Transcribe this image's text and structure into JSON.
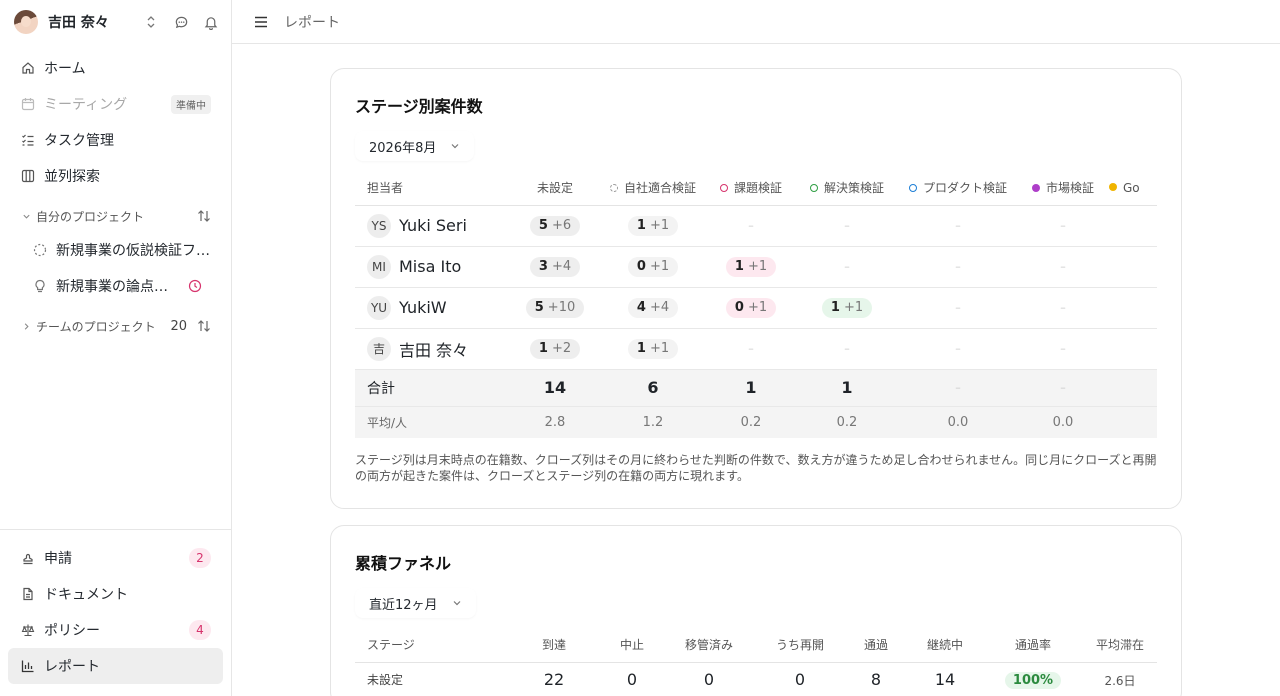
{
  "user": {
    "name": "吉田 奈々"
  },
  "nav": {
    "home": "ホーム",
    "meeting": "ミーティング",
    "meeting_badge": "準備中",
    "tasks": "タスク管理",
    "parallel": "並列探索"
  },
  "my_projects": {
    "title": "自分のプロジェクト",
    "items": [
      {
        "label": "新規事業の仮説検証フレームワーク"
      },
      {
        "label": "新規事業の論点整理"
      }
    ]
  },
  "team_projects": {
    "title": "チームのプロジェクト",
    "count": "20"
  },
  "bottom_nav": {
    "apply": "申請",
    "apply_count": "2",
    "docs": "ドキュメント",
    "policy": "ポリシー",
    "policy_count": "4",
    "report": "レポート"
  },
  "topbar": {
    "breadcrumb": "レポート"
  },
  "stage_card": {
    "title": "ステージ別案件数",
    "period": "2026年8月",
    "headers": [
      "担当者",
      "未設定",
      "自社適合検証",
      "課題検証",
      "解決策検証",
      "プロダクト検証",
      "市場検証",
      "Go"
    ],
    "rows": [
      {
        "initials": "YS",
        "name": "Yuki Seri",
        "unset": [
          "5",
          "+6"
        ],
        "fit": [
          "1",
          "+1"
        ],
        "issue": null,
        "solution": null
      },
      {
        "initials": "MI",
        "name": "Misa Ito",
        "unset": [
          "3",
          "+4"
        ],
        "fit": [
          "0",
          "+1"
        ],
        "issue": [
          "1",
          "+1"
        ],
        "solution": null
      },
      {
        "initials": "YU",
        "name": "YukiW",
        "unset": [
          "5",
          "+10"
        ],
        "fit": [
          "4",
          "+4"
        ],
        "issue": [
          "0",
          "+1"
        ],
        "solution": [
          "1",
          "+1"
        ]
      },
      {
        "initials": "吉",
        "name": "吉田 奈々",
        "unset": [
          "1",
          "+2"
        ],
        "fit": [
          "1",
          "+1"
        ],
        "issue": null,
        "solution": null
      }
    ],
    "empty_mark": "–",
    "total": {
      "label": "合計",
      "unset": "14",
      "fit": "6",
      "issue": "1",
      "solution": "1"
    },
    "average": {
      "label": "平均/人",
      "unset": "2.8",
      "fit": "1.2",
      "issue": "0.2",
      "solution": "0.2",
      "product": "0.0",
      "market": "0.0"
    },
    "note": "ステージ列は月末時点の在籍数、クローズ列はその月に終わらせた判断の件数で、数え方が違うため足し合わせられません。同じ月にクローズと再開の両方が起きた案件は、クローズとステージ列の在籍の両方に現れます。"
  },
  "funnel_card": {
    "title": "累積ファネル",
    "period": "直近12ヶ月",
    "headers": [
      "ステージ",
      "到達",
      "中止",
      "移管済み",
      "うち再開",
      "通過",
      "継続中",
      "通過率",
      "平均滞在"
    ],
    "rows": [
      {
        "stage": "未設定",
        "reached": "22",
        "stopped": "0",
        "transferred": "0",
        "reopened": "0",
        "passed": "8",
        "ongoing": "14",
        "rate": "100%",
        "avg_stay": "2.6日"
      }
    ]
  },
  "colors": {
    "accent_pink": "#d6336c",
    "green": "#2f9e44",
    "blue": "#1c7ed6",
    "purple": "#ae3ec9",
    "yellow": "#f0b400"
  }
}
